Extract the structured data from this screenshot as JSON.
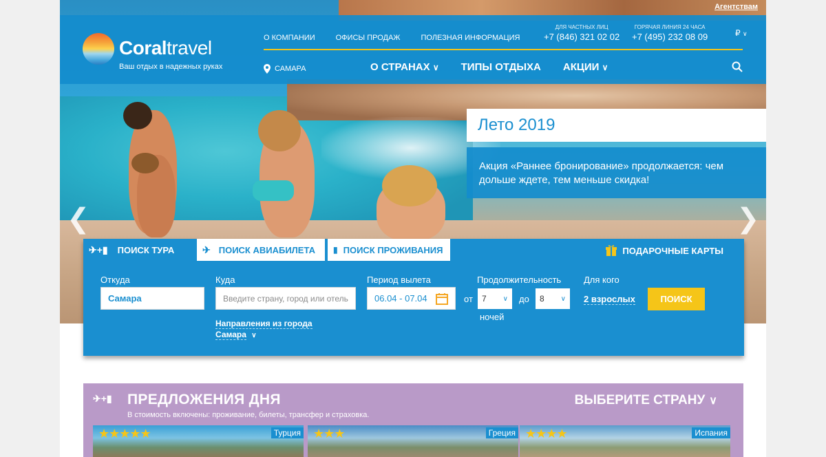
{
  "header": {
    "agents_link": "Агентствам",
    "logo_main": "Coral",
    "logo_second": "travel",
    "tagline": "Ваш отдых в надежных руках",
    "top_nav": [
      "О КОМПАНИИ",
      "ОФИСЫ ПРОДАЖ",
      "ПОЛЕЗНАЯ ИНФОРМАЦИЯ"
    ],
    "phones": [
      {
        "label": "ДЛЯ ЧАСТНЫХ ЛИЦ",
        "number": "+7 (846) 321 02 02"
      },
      {
        "label": "ГОРЯЧАЯ ЛИНИЯ 24 ЧАСА",
        "number": "+7 (495) 232 08 09"
      }
    ],
    "currency": "₽",
    "city": "САМАРА",
    "main_nav": [
      "О СТРАНАХ",
      "ТИПЫ ОТДЫХА",
      "АКЦИИ"
    ]
  },
  "promo": {
    "title": "Лето 2019",
    "text": "Акция «Раннее бронирование» продолжается: чем дольше ждете, тем меньше скидка!"
  },
  "search": {
    "tabs": [
      "ПОИСК ТУРА",
      "ПОИСК АВИАБИЛЕТА",
      "ПОИСК ПРОЖИВАНИЯ"
    ],
    "gift": "ПОДАРОЧНЫЕ КАРТЫ",
    "from_label": "Откуда",
    "from_value": "Самара",
    "to_label": "Куда",
    "to_placeholder": "Введите страну, город или отель",
    "period_label": "Период вылета",
    "period_value": "06.04 - 07.04",
    "duration_label": "Продолжительность",
    "from_word": "от",
    "to_word": "до",
    "nights_from": "7",
    "nights_to": "8",
    "nights_word": "ночей",
    "who_label": "Для кого",
    "who_value": "2 взрослых",
    "button": "ПОИСК",
    "dir_line1": "Направления из города",
    "dir_line2": "Самара"
  },
  "offers": {
    "title": "ПРЕДЛОЖЕНИЯ ДНЯ",
    "subtitle": "В стоимость включены: проживание, билеты, трансфер и страховка.",
    "choose_country": "ВЫБЕРИТЕ СТРАНУ",
    "cards": [
      {
        "stars": "★★★★★",
        "country": "Турция"
      },
      {
        "stars": "★★★",
        "country": "Греция"
      },
      {
        "stars": "★★★★",
        "country": "Испания"
      }
    ]
  },
  "colors": {
    "brand_blue": "#1a8fd0",
    "accent_yellow": "#f5c518",
    "offers_purple": "#b99ac8"
  }
}
